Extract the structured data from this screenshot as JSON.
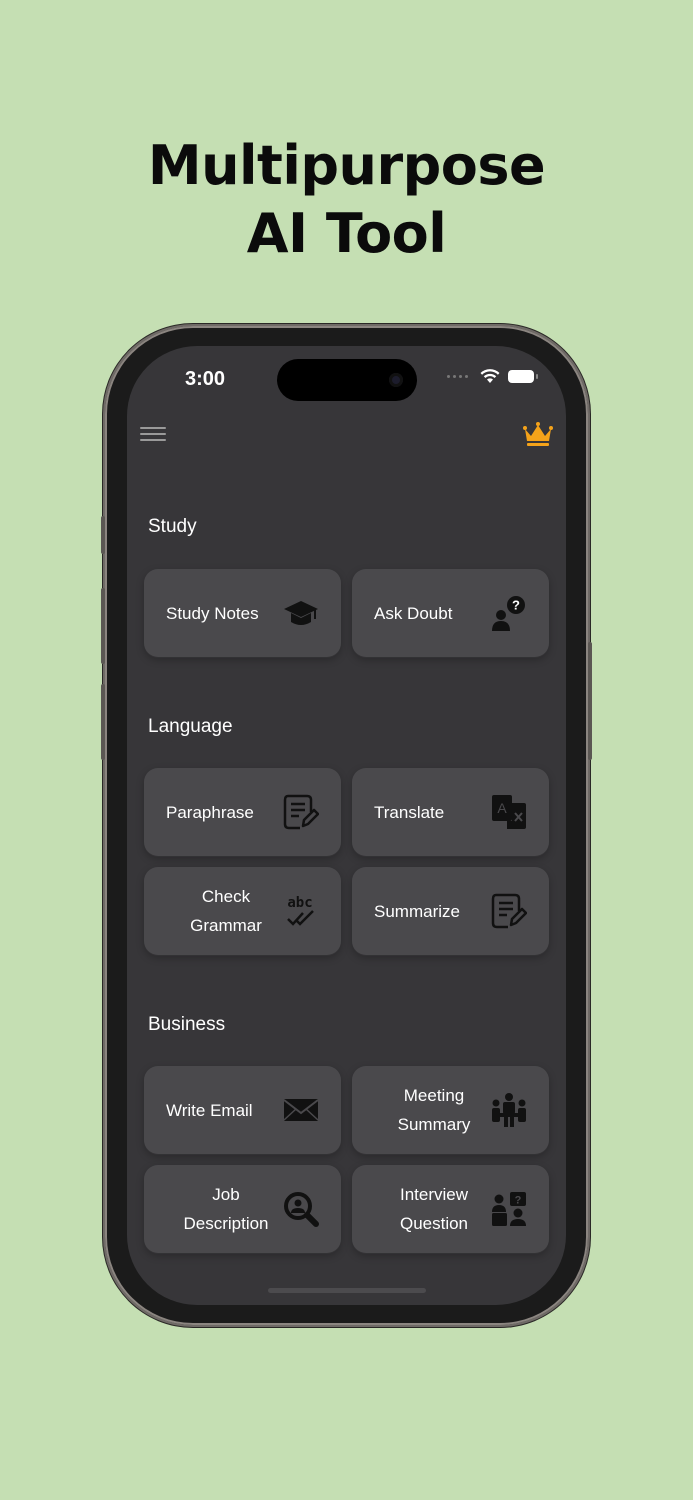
{
  "headline": {
    "line1": "Multipurpose",
    "line2": "AI Tool"
  },
  "status_bar": {
    "time": "3:00"
  },
  "colors": {
    "background": "#c5dfb3",
    "screen": "#373639",
    "card": "#4a494c",
    "crown": "#f5a31a"
  },
  "sections": {
    "study": {
      "title": "Study",
      "cards": [
        {
          "label": "Study Notes",
          "icon": "graduation-cap-icon"
        },
        {
          "label": "Ask Doubt",
          "icon": "user-question-icon"
        }
      ]
    },
    "language": {
      "title": "Language",
      "cards": [
        {
          "label": "Paraphrase",
          "icon": "document-edit-icon"
        },
        {
          "label": "Translate",
          "icon": "translate-icon"
        },
        {
          "label_line1": "Check",
          "label_line2": "Grammar",
          "icon": "spellcheck-icon"
        },
        {
          "label": "Summarize",
          "icon": "document-edit-icon"
        }
      ]
    },
    "business": {
      "title": "Business",
      "cards": [
        {
          "label": "Write Email",
          "icon": "envelope-icon"
        },
        {
          "label_line1": "Meeting",
          "label_line2": "Summary",
          "icon": "meeting-icon"
        },
        {
          "label_line1": "Job",
          "label_line2": "Description",
          "icon": "search-person-icon"
        },
        {
          "label_line1": "Interview",
          "label_line2": "Question",
          "icon": "interview-icon"
        }
      ]
    }
  }
}
